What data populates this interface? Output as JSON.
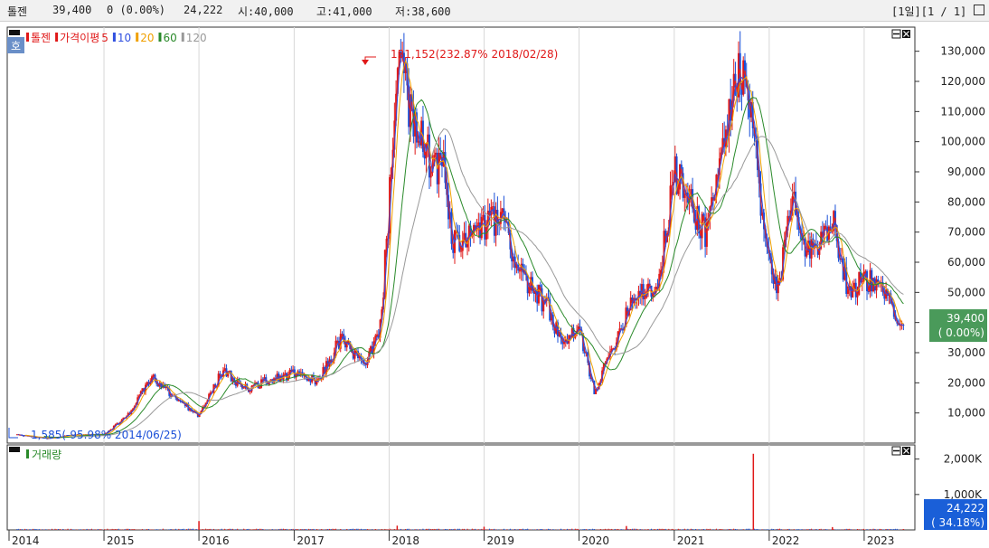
{
  "header": {
    "name": "톨젠",
    "price": "39,400",
    "change": "0 (0.00%)",
    "volume": "24,222",
    "open": "시:40,000",
    "high": "고:41,000",
    "low": "저:38,600",
    "period": "[1일][1 / 1]"
  },
  "legend": {
    "hoga_tag": "호",
    "stock_name": "톨젠",
    "ma_label": "가격이평",
    "ma_periods": [
      "5",
      "10",
      "20",
      "60",
      "120"
    ],
    "ma_colors": [
      "#e02020",
      "#3050e0",
      "#f0a000",
      "#2a8a2a",
      "#999999"
    ],
    "volume_label": "거래량"
  },
  "colors": {
    "up": "#e01818",
    "down": "#1a4fd8",
    "price_tag_bg": "#4a9a5a",
    "volume_tag_bg": "#1a5fd8"
  },
  "annotations": {
    "high_label": "131,152(232.87% 2018/02/28)",
    "low_label": "1,585(-95.98% 2014/06/25)"
  },
  "tags": {
    "price": "39,400",
    "price_pct": "( 0.00%)",
    "volume": "24,222",
    "volume_pct": "( 34.18%)"
  },
  "chart_data": {
    "type": "candlestick",
    "title": "",
    "x_tick_labels": [
      "2014",
      "2015",
      "2016",
      "2017",
      "2018",
      "2019",
      "2020",
      "2021",
      "2022",
      "2023"
    ],
    "price_axis": {
      "ylim": [
        0,
        138000
      ],
      "tick_values": [
        10000,
        20000,
        30000,
        40000,
        50000,
        60000,
        70000,
        80000,
        90000,
        100000,
        110000,
        120000,
        130000
      ],
      "tick_labels": [
        "10,000",
        "20,000",
        "30,000",
        "40,000",
        "50,000",
        "60,000",
        "70,000",
        "80,000",
        "90,000",
        "100,000",
        "110,000",
        "120,000",
        "130,000"
      ]
    },
    "volume_axis": {
      "ylim": [
        0,
        2400
      ],
      "tick_values": [
        1000,
        2000
      ],
      "tick_labels": [
        "1,000K",
        "2,000K"
      ]
    },
    "price_path": [
      {
        "date": "2014-02",
        "close": 2800
      },
      {
        "date": "2014-06",
        "close": 1585
      },
      {
        "date": "2014-09",
        "close": 2600
      },
      {
        "date": "2015-01",
        "close": 2800
      },
      {
        "date": "2015-04",
        "close": 9000
      },
      {
        "date": "2015-07",
        "close": 22000
      },
      {
        "date": "2015-10",
        "close": 15000
      },
      {
        "date": "2016-01",
        "close": 9000
      },
      {
        "date": "2016-04",
        "close": 24000
      },
      {
        "date": "2016-07",
        "close": 18000
      },
      {
        "date": "2016-10",
        "close": 21000
      },
      {
        "date": "2017-01",
        "close": 23000
      },
      {
        "date": "2017-04",
        "close": 20000
      },
      {
        "date": "2017-07",
        "close": 35000
      },
      {
        "date": "2017-10",
        "close": 25000
      },
      {
        "date": "2017-12",
        "close": 40000
      },
      {
        "date": "2018-01",
        "close": 80000
      },
      {
        "date": "2018-02",
        "close": 131152
      },
      {
        "date": "2018-04",
        "close": 105000
      },
      {
        "date": "2018-06",
        "close": 95000
      },
      {
        "date": "2018-08",
        "close": 90000
      },
      {
        "date": "2018-09",
        "close": 65000
      },
      {
        "date": "2018-12",
        "close": 70000
      },
      {
        "date": "2019-03",
        "close": 75000
      },
      {
        "date": "2019-06",
        "close": 55000
      },
      {
        "date": "2019-09",
        "close": 45000
      },
      {
        "date": "2019-11",
        "close": 32000
      },
      {
        "date": "2020-01",
        "close": 38000
      },
      {
        "date": "2020-03",
        "close": 17000
      },
      {
        "date": "2020-05",
        "close": 30000
      },
      {
        "date": "2020-08",
        "close": 50000
      },
      {
        "date": "2020-11",
        "close": 52000
      },
      {
        "date": "2021-01",
        "close": 90000
      },
      {
        "date": "2021-03",
        "close": 80000
      },
      {
        "date": "2021-05",
        "close": 70000
      },
      {
        "date": "2021-07",
        "close": 95000
      },
      {
        "date": "2021-09",
        "close": 125000
      },
      {
        "date": "2021-11",
        "close": 105000
      },
      {
        "date": "2021-12",
        "close": 75000
      },
      {
        "date": "2022-02",
        "close": 48000
      },
      {
        "date": "2022-04",
        "close": 85000
      },
      {
        "date": "2022-06",
        "close": 62000
      },
      {
        "date": "2022-09",
        "close": 75000
      },
      {
        "date": "2022-11",
        "close": 50000
      },
      {
        "date": "2023-01",
        "close": 55000
      },
      {
        "date": "2023-04",
        "close": 48000
      },
      {
        "date": "2023-06",
        "close": 39400
      }
    ],
    "volume_spikes": [
      {
        "date": "2016-01",
        "volume": 250
      },
      {
        "date": "2018-02",
        "volume": 120
      },
      {
        "date": "2019-01",
        "volume": 90
      },
      {
        "date": "2020-07",
        "volume": 110
      },
      {
        "date": "2021-11",
        "volume": 2150
      },
      {
        "date": "2022-09",
        "volume": 80
      },
      {
        "date": "2023-06",
        "volume": 24
      }
    ]
  }
}
